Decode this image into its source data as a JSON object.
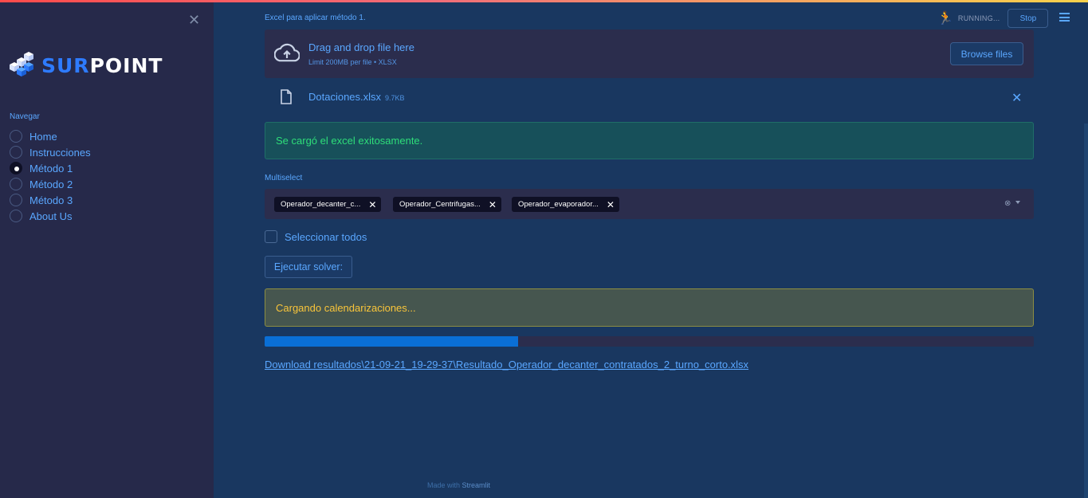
{
  "sidebar": {
    "logo_part1": "SUR",
    "logo_part2": "POINT",
    "nav_label": "Navegar",
    "items": [
      {
        "label": "Home",
        "selected": false
      },
      {
        "label": "Instrucciones",
        "selected": false
      },
      {
        "label": "Método 1",
        "selected": true
      },
      {
        "label": "Método 2",
        "selected": false
      },
      {
        "label": "Método 3",
        "selected": false
      },
      {
        "label": "About Us",
        "selected": false
      }
    ]
  },
  "header": {
    "status": "RUNNING...",
    "stop_label": "Stop"
  },
  "uploader": {
    "label": "Excel para aplicar método 1.",
    "drop_title": "Drag and drop file here",
    "limit": "Limit 200MB per file • XLSX",
    "browse_label": "Browse files",
    "file_name": "Dotaciones.xlsx",
    "file_size": "9.7KB"
  },
  "success_msg": "Se cargó el excel exitosamente.",
  "multiselect": {
    "label": "Multiselect",
    "tags": [
      "Operador_decanter_c...",
      "Operador_Centrifugas...",
      "Operador_evaporador..."
    ]
  },
  "select_all_label": "Seleccionar todos",
  "execute_label": "Ejecutar solver:",
  "warning_msg": "Cargando calendarizaciones...",
  "progress": 0.33,
  "download_link": "Download resultados\\21-09-21_19-29-37\\Resultado_Operador_decanter_contratados_2_turno_corto.xlsx",
  "footer": {
    "made_with": "Made with",
    "brand": "Streamlit"
  },
  "colors": {
    "accent": "#5aa7ff",
    "success": "#2ede79",
    "warning": "#f9c53a",
    "progress": "#0a6fd6"
  }
}
